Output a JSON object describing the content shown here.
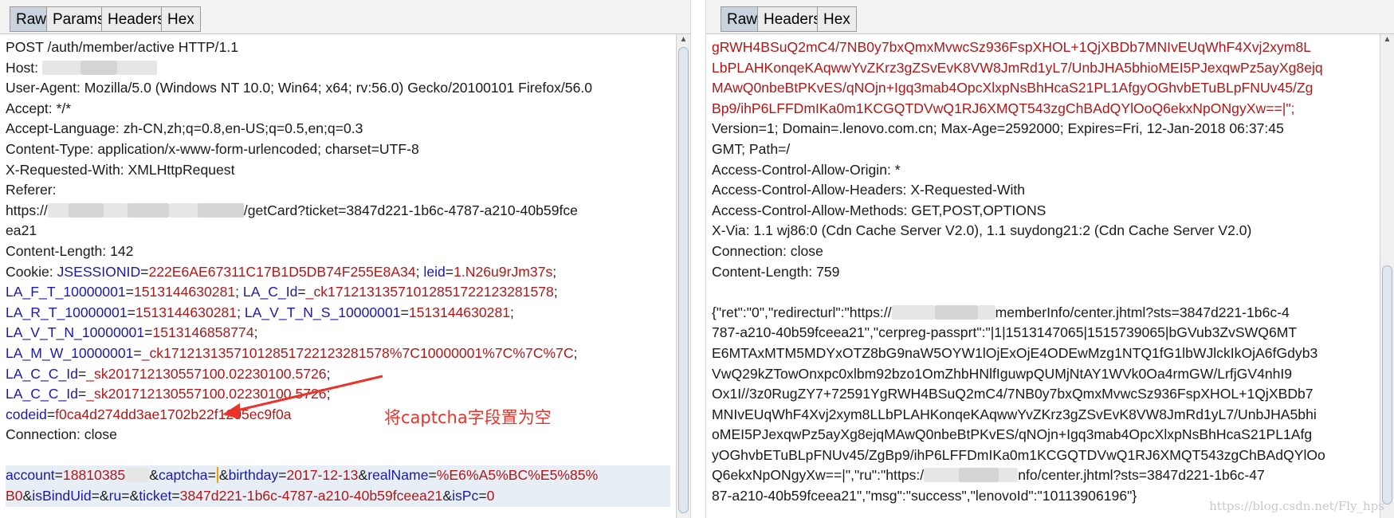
{
  "request": {
    "tabs": [
      "Raw",
      "Params",
      "Headers",
      "Hex"
    ],
    "active_tab": "Raw",
    "request_line": "POST /auth/member/active HTTP/1.1",
    "host_label": "Host:",
    "user_agent": "User-Agent: Mozilla/5.0 (Windows NT 10.0; Win64; x64; rv:56.0) Gecko/20100101 Firefox/56.0",
    "accept": "Accept: */*",
    "accept_language": "Accept-Language: zh-CN,zh;q=0.8,en-US;q=0.5,en;q=0.3",
    "content_type": "Content-Type: application/x-www-form-urlencoded; charset=UTF-8",
    "x_requested_with": "X-Requested-With: XMLHttpRequest",
    "referer_label": "Referer:",
    "referer_prefix": "https://",
    "referer_suffix": "/getCard?ticket=3847d221-1b6c-4787-a210-40b59fce",
    "referer_wrap": "ea21",
    "content_length": "Content-Length: 142",
    "cookie_label": "Cookie: ",
    "cookies": [
      {
        "k": "JSESSIONID",
        "v": "222E6AE67311C17B1D5DB74F255E8A34"
      },
      {
        "k": "leid",
        "v": "1.N26u9rJm37s"
      },
      {
        "k": "LA_F_T_10000001",
        "v": "1513144630281"
      },
      {
        "k": "LA_C_Id",
        "v": "_ck17121313571012851722123281578"
      },
      {
        "k": "LA_R_T_10000001",
        "v": "1513144630281"
      },
      {
        "k": "LA_V_T_N_S_10000001",
        "v": "1513144630281"
      },
      {
        "k": "LA_V_T_N_10000001",
        "v": "1513146858774"
      },
      {
        "k": "LA_M_W_10000001",
        "v": "_ck17121313571012851722123281578%7C10000001%7C%7C%7C"
      },
      {
        "k": "LA_C_C_Id",
        "v": "_sk201712130557100.02230100.5726"
      },
      {
        "k": "LA_C_C_Id",
        "v": "_sk201712130557100.02230100.5726"
      },
      {
        "k": "codeid",
        "v": "f0ca4d274dd3ae1702b22f1205ec9f0a"
      }
    ],
    "connection": "Connection: close",
    "body": {
      "account_k": "account",
      "account_v": "18810385",
      "captcha_k": "captcha",
      "captcha_v": "",
      "birthday_k": "birthday",
      "birthday_v": "2017-12-13",
      "realName_k": "realName",
      "realName_v": "%E6%A5%BC%E5%85%",
      "realName_wrap": "B0",
      "isBindUid_k": "isBindUid",
      "isBindUid_v": "",
      "ru_k": "ru",
      "ru_v": "",
      "ticket_k": "ticket",
      "ticket_v": "3847d221-1b6c-4787-a210-40b59fceea21",
      "isPc_k": "isPc",
      "isPc_v": "0"
    },
    "annotation": "将captcha字段置为空"
  },
  "response": {
    "tabs": [
      "Raw",
      "Headers",
      "Hex"
    ],
    "active_tab": "Raw",
    "cookie_lines": [
      "gRWH4BSuQ2mC4/7NB0y7bxQmxMvwcSz936FspXHOL+1QjXBDb7MNIvEUqWhF4Xvj2xym8L",
      "LbPLAHKonqeKAqwwYvZKrz3gZSvEvK8VW8JmRd1yL7/UnbJHA5bhioMEI5PJexqwPz5ayXg8ejq",
      "MAwQ0nbeBtPKvES/qNOjn+Igq3mab4OpcXlxpNsBhHcaS21PL1AfgyOGhvbETuBLpFNUv45/Zg",
      "Bp9/ihP6LFFDmIKa0m1KCGQTDVwQ1RJ6XMQT543zgChBAdQYlOoQ6ekxNpONgyXw==|\";"
    ],
    "version_line": "Version=1; Domain=.lenovo.com.cn; Max-Age=2592000; Expires=Fri, 12-Jan-2018 06:37:45",
    "gmt_line": "GMT; Path=/",
    "acao": "Access-Control-Allow-Origin: *",
    "acah": "Access-Control-Allow-Headers: X-Requested-With",
    "acam": "Access-Control-Allow-Methods: GET,POST,OPTIONS",
    "xvia": "X-Via: 1.1 wj86:0 (Cdn Cache Server V2.0), 1.1 suydong21:2 (Cdn Cache Server V2.0)",
    "connection": "Connection: close",
    "content_length": "Content-Length: 759",
    "body_first_prefix": "{\"ret\":\"0\",\"redirecturl\":\"https://",
    "body_first_suffix": "memberInfo/center.jhtml?sts=3847d221-1b6c-4",
    "body_lines": [
      "787-a210-40b59fceea21\",\"cerpreg-passprt\":\"|1|1513147065|1515739065|bGVub3ZvSWQ6MT",
      "E6MTAxMTM5MDYxOTZ8bG9naW5OYW1lOjExOjE4ODEwMzg1NTQ1fG1lbWJlckIkOjA6fGdyb3",
      "VwQ29kZTowOnxpc0xlbm92bzo1OmZhbHNlfIguwpQUMjNtAY1WVk0Oa4rmGW/LrfjGV4nhI9",
      "Ox1I//3z0RugZY7+72591YgRWH4BSuQ2mC4/7NB0y7bxQmxMvwcSz936FspXHOL+1QjXBDb7",
      "MNIvEUqWhF4Xvj2xym8LLbPLAHKonqeKAqwwYvZKrz3gZSvEvK8VW8JmRd1yL7/UnbJHA5bhi",
      "oMEI5PJexqwPz5ayXg8ejqMAwQ0nbeBtPKvES/qNOjn+Igq3mab4OpcXlxpNsBhHcaS21PL1Afg",
      "yOGhvbETuBLpFNUv45/ZgBp9/ihP6LFFDmIKa0m1KCGQTDVwQ1RJ6XMQT543zgChBAdQYlOo",
      "Q6ekxNpONgyXw==|\",\"ru\":\"https:/"
    ],
    "body_ru_suffix": "nfo/center.jhtml?sts=3847d221-1b6c-47",
    "body_last": "87-a210-40b59fceea21\",\"msg\":\"success\",\"lenovoId\":\"10113906196\"}",
    "watermark": "https://blog.csdn.net/Fly_hps"
  }
}
